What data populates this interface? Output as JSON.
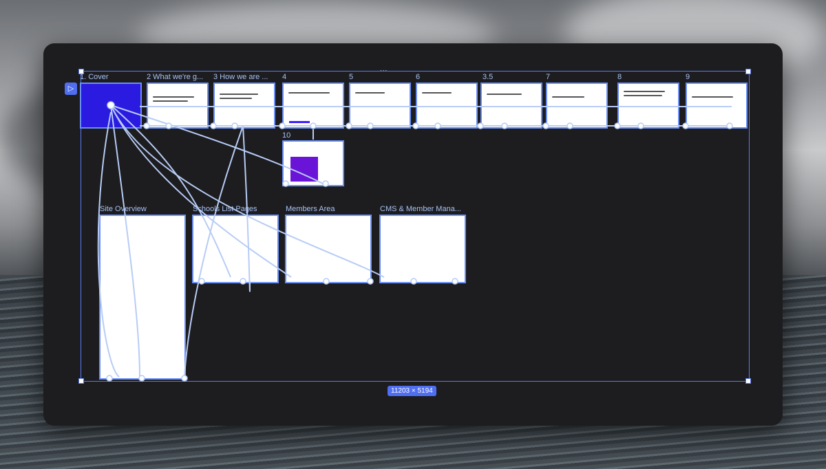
{
  "canvas": {
    "dimensions_label": "11203 × 5194",
    "top_handle": "...",
    "flow_start_icon": "play-frame-icon"
  },
  "frames": [
    {
      "title": "1. Cover",
      "kind": "cover"
    },
    {
      "title": "2 What we're g..."
    },
    {
      "title": "3 How we are ..."
    },
    {
      "title": "4"
    },
    {
      "title": "5"
    },
    {
      "title": "6"
    },
    {
      "title": "3.5"
    },
    {
      "title": "7"
    },
    {
      "title": "8"
    },
    {
      "title": "9"
    },
    {
      "title": "10"
    },
    {
      "title": "Site Overview"
    },
    {
      "title": "Schools List Pages"
    },
    {
      "title": "Members Area"
    },
    {
      "title": "CMS & Member Mana..."
    }
  ],
  "colors": {
    "accent": "#5b7bf0",
    "cover": "#2b1be0",
    "link": "#b7ccf6"
  }
}
